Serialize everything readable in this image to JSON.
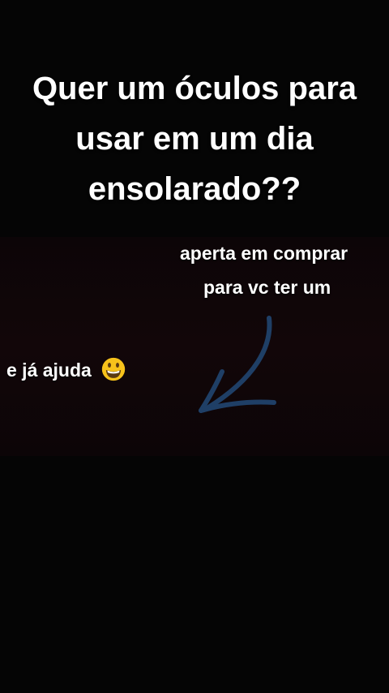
{
  "headline": {
    "line1": "Quer um óculos para",
    "line2": "usar em um dia",
    "line3": "ensolarado??"
  },
  "captions": {
    "line1": "aperta em comprar",
    "line2": "para vc ter um",
    "line3": "e já ajuda"
  },
  "icons": {
    "smile": "grinning-face-emoji",
    "arrow": "hand-drawn-arrow-icon"
  },
  "colors": {
    "background": "#050505",
    "video_band": "#120609",
    "text": "#ffffff",
    "arrow": "#1f3f66",
    "emoji_face": "#f7c21b"
  }
}
